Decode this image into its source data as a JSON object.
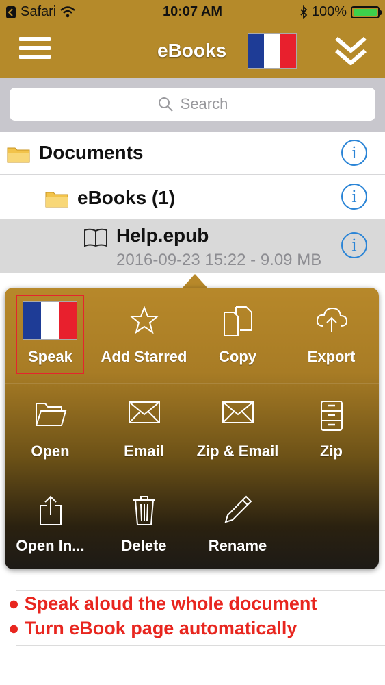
{
  "status": {
    "carrier": "Safari",
    "time": "10:07 AM",
    "battery": "100%"
  },
  "nav": {
    "title": "eBooks"
  },
  "search": {
    "placeholder": "Search"
  },
  "files": [
    {
      "label": "Documents",
      "type": "folder"
    },
    {
      "label": "eBooks (1)",
      "type": "folder"
    },
    {
      "label": "Help.epub",
      "type": "book",
      "meta": "2016-09-23 15:22 - 9.09 MB"
    }
  ],
  "actions": [
    {
      "label": "Speak",
      "icon": "flag-france-icon"
    },
    {
      "label": "Add Starred",
      "icon": "star-icon"
    },
    {
      "label": "Copy",
      "icon": "copy-icon"
    },
    {
      "label": "Export",
      "icon": "cloud-upload-icon"
    },
    {
      "label": "Open",
      "icon": "folder-open-icon"
    },
    {
      "label": "Email",
      "icon": "envelope-icon"
    },
    {
      "label": "Zip & Email",
      "icon": "envelope-icon"
    },
    {
      "label": "Zip",
      "icon": "zip-cabinet-icon"
    },
    {
      "label": "Open In...",
      "icon": "share-icon"
    },
    {
      "label": "Delete",
      "icon": "trash-icon"
    },
    {
      "label": "Rename",
      "icon": "pencil-icon"
    }
  ],
  "notes": [
    "● Speak aloud the whole document",
    "● Turn eBook page automatically"
  ],
  "colors": {
    "gold": "#b58a2a",
    "info_blue": "#2a84d6",
    "note_red": "#e8261f"
  }
}
